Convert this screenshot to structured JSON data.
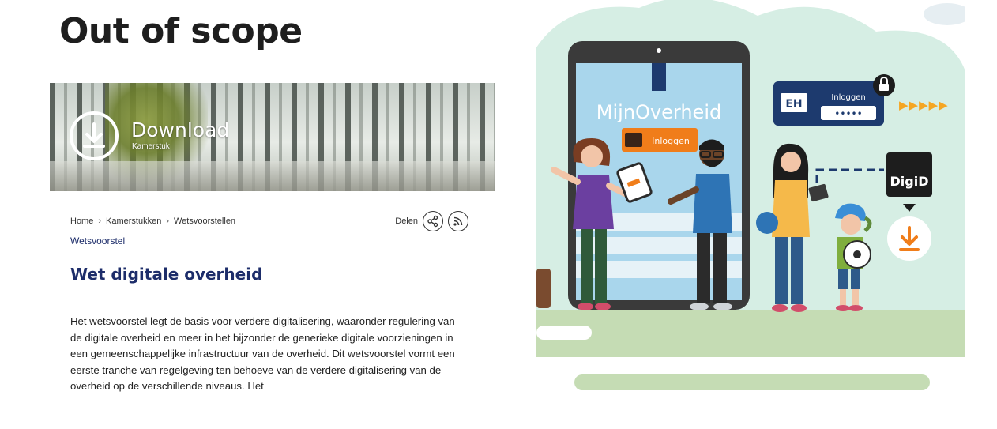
{
  "slide": {
    "title": "Out of scope"
  },
  "site": {
    "banner": {
      "label": "Download",
      "sub_label": "Kamerstuk"
    },
    "breadcrumb": [
      "Home",
      "Kamerstukken",
      "Wetsvoorstellen"
    ],
    "breadcrumb_separator": "›",
    "share_label": "Delen",
    "doc_type": "Wetsvoorstel",
    "doc_title": "Wet digitale overheid",
    "body": "Het wetsvoorstel legt de basis voor verdere digitalisering, waaronder regulering van de digitale overheid en meer in het bijzonder de generieke digitale voorzieningen in een gemeenschappelijke infrastructuur van de overheid. Dit wetsvoorstel vormt een eerste tranche van regelgeving ten behoeve van de verdere digitalisering van de overheid op de verschillende niveaus. Het"
  },
  "illustration": {
    "app_name": "MijnOverheid",
    "login_label": "Inloggen",
    "eh_label": "EH",
    "eh_login_label": "Inloggen",
    "password_mask": "•••••",
    "arrows": "▶▶▶▶▶",
    "digid_label": "DigiD",
    "colors": {
      "cloud": "#d6eee4",
      "ground": "#c5dcb4",
      "accent_orange": "#f07d1a",
      "navy": "#1d3a6e",
      "phone": "#3a3a3a",
      "screen": "#a9d6ec"
    }
  },
  "icons": [
    "download-icon",
    "share-icon",
    "rss-icon",
    "lock-icon",
    "download-arrow-icon",
    "play-arrows-icon"
  ]
}
